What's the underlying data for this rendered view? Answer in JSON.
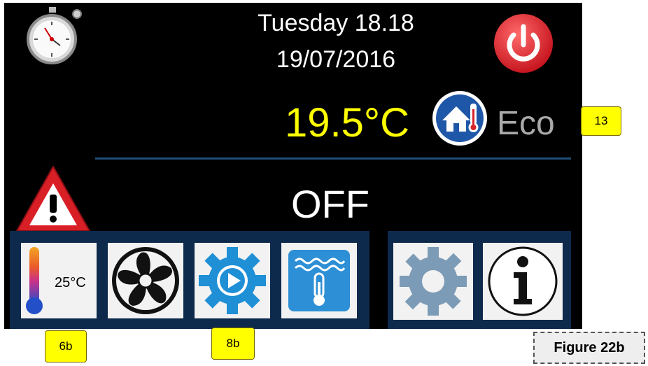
{
  "status": {
    "day_time": "Tuesday 18.18",
    "date": "19/07/2016",
    "temperature": "19.5°C",
    "mode": "Eco",
    "state": "OFF"
  },
  "toolbar": {
    "setpoint": "25°C"
  },
  "callouts": {
    "c13": "13",
    "c6b": "6b",
    "c8b": "8b"
  },
  "figure_label": "Figure 22b",
  "icons": {
    "clock": "stopwatch-icon",
    "power": "power-icon",
    "home_temp": "home-thermometer-icon",
    "warning": "warning-icon",
    "thermometer": "thermometer-icon",
    "fan": "fan-icon",
    "program": "program-gear-play-icon",
    "water": "water-temperature-icon",
    "settings": "settings-gear-icon",
    "info": "info-icon"
  },
  "colors": {
    "screen_bg": "#000000",
    "temperature_text": "#ffff00",
    "mode_text": "#a9a9a9",
    "panel": "#0d2a4d",
    "power_button": "#d81f26",
    "callout": "#ffff00"
  }
}
